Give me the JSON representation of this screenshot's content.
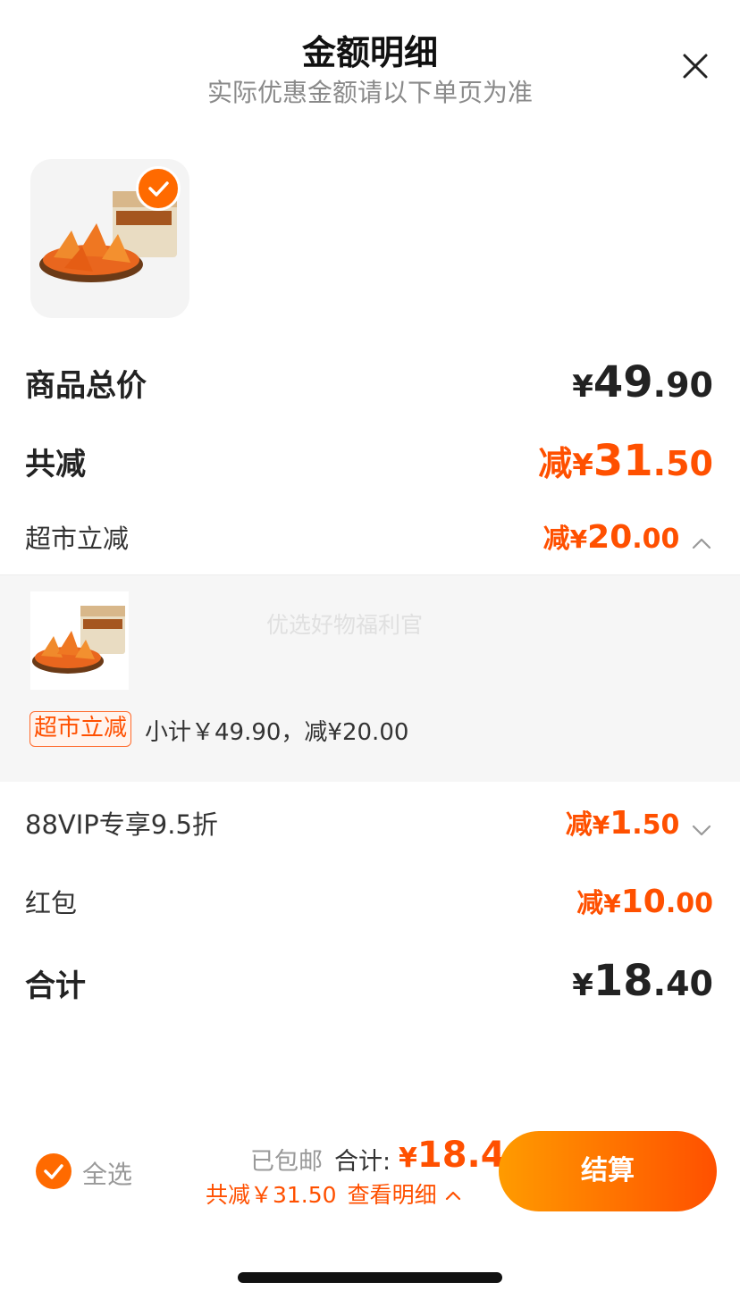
{
  "header": {
    "title": "金额明细",
    "subtitle": "实际优惠金额请以下单页为准",
    "close_icon": "close-icon"
  },
  "product": {
    "image_icon": "product-image",
    "selected": true
  },
  "rows": {
    "total_goods": {
      "label": "商品总价",
      "yen": "¥",
      "int": "49",
      "dec": ".90"
    },
    "total_discount": {
      "label": "共减",
      "prefix": "减",
      "yen": "¥",
      "int": "31",
      "dec": ".50"
    },
    "supermarket": {
      "label": "超市立减",
      "prefix": "减",
      "yen": "¥",
      "int": "20",
      "dec": ".00",
      "chevron": "chevron-up-icon"
    },
    "vip": {
      "label": "88VIP专享9.5折",
      "prefix": "减",
      "yen": "¥",
      "int": "1",
      "dec": ".50",
      "chevron": "chevron-down-icon"
    },
    "redpacket": {
      "label": "红包",
      "prefix": "减",
      "yen": "¥",
      "int": "10",
      "dec": ".00"
    },
    "sum": {
      "label": "合计",
      "yen": "¥",
      "int": "18",
      "dec": ".40"
    }
  },
  "detail": {
    "watermark": "优选好物福利官",
    "tag": "超市立减",
    "text": "小计￥49.90，减¥20.00"
  },
  "footer": {
    "select_all": "全选",
    "shipping": "已包邮",
    "total_label": "合计:",
    "total_yen": "¥",
    "total_value": "18.4",
    "saved": "共减￥31.50",
    "view_detail": "查看明细",
    "checkout": "结算"
  },
  "colors": {
    "accent": "#ff5000",
    "accent_light": "#ff9b00"
  }
}
